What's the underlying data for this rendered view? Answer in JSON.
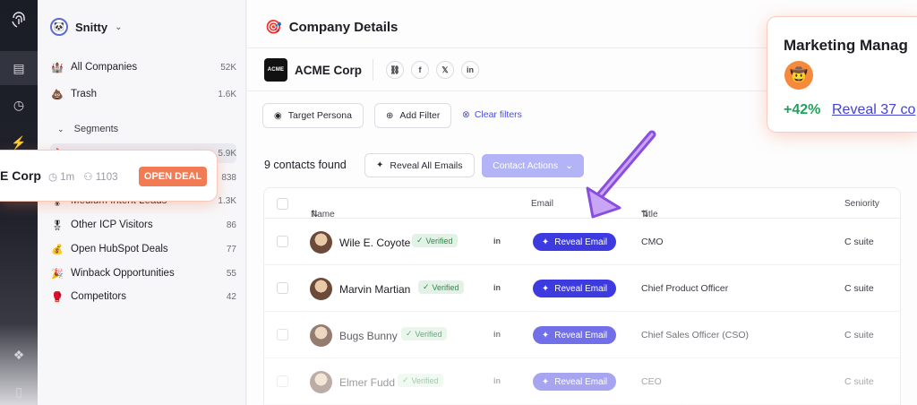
{
  "workspace": {
    "name": "Snitty"
  },
  "nav": [
    {
      "icon": "🏰",
      "label": "All Companies",
      "count": "52K"
    },
    {
      "icon": "💩",
      "label": "Trash",
      "count": "1.6K"
    }
  ],
  "segments": {
    "header": "Segments",
    "items": [
      {
        "icon": "🔥",
        "label": "",
        "count": "5.9K"
      },
      {
        "icon": "🌡",
        "label": "",
        "count": "838"
      },
      {
        "icon": "🌡",
        "label": "Medium Intent Leads",
        "count": "1.3K"
      },
      {
        "icon": "🎖",
        "label": "Other ICP Visitors",
        "count": "86"
      },
      {
        "icon": "💰",
        "label": "Open HubSpot Deals",
        "count": "77"
      },
      {
        "icon": "🎉",
        "label": "Winback Opportunities",
        "count": "55"
      },
      {
        "icon": "🥊",
        "label": "Competitors",
        "count": "42"
      }
    ]
  },
  "page": {
    "title": "Company Details",
    "title_icon": "🎯"
  },
  "company": {
    "name": "ACME Corp",
    "logo_text": "ACME"
  },
  "filters": {
    "persona": "Target Persona",
    "add": "Add Filter",
    "clear": "Clear filters"
  },
  "contacts": {
    "found": "9 contacts found",
    "reveal_all": "Reveal All Emails",
    "actions": "Contact Actions",
    "columns": {
      "name": "Name",
      "email": "Email",
      "title": "Title",
      "seniority": "Seniority"
    },
    "rows": [
      {
        "name": "Wile E. Coyote",
        "verified": "Verified",
        "linkedin": "in",
        "email_action": "Reveal Email",
        "title": "CMO",
        "seniority": "C suite"
      },
      {
        "name": "Marvin Martian",
        "verified": "Verified",
        "linkedin": "in",
        "email_action": "Reveal Email",
        "title": "Chief Product Officer",
        "seniority": "C suite"
      },
      {
        "name": "Bugs Bunny",
        "verified": "Verified",
        "linkedin": "in",
        "email_action": "Reveal Email",
        "title": "Chief Sales Officer (CSO)",
        "seniority": "C suite"
      },
      {
        "name": "Elmer Fudd",
        "verified": "Verified",
        "linkedin": "in",
        "email_action": "Reveal Email",
        "title": "CEO",
        "seniority": "C suite"
      }
    ]
  },
  "deal_card": {
    "company": "E Corp",
    "time": "1m",
    "people": "1103",
    "button": "OPEN DEAL"
  },
  "marketing_card": {
    "title": "Marketing Manag",
    "change": "+42%",
    "reveal": "Reveal 37 co"
  },
  "colors": {
    "accent": "#3d3ae0",
    "deal": "#f07b54",
    "positive": "#1fa35a"
  }
}
